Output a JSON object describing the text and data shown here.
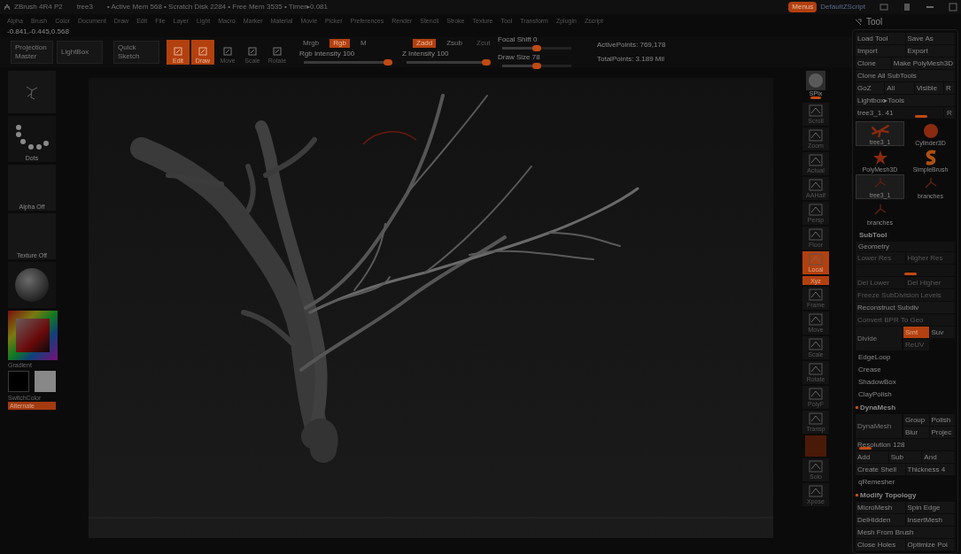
{
  "title_bar": {
    "app": "ZBrush 4R4 P2",
    "document": "tree3",
    "status": "• Active Mem 568 • Scratch Disk 2284 • Free Mem 3535 • Timer▸0.081",
    "menus_button": {
      "label": "Menus",
      "selected": true
    },
    "script": "DefaultZScript"
  },
  "menu_bar": [
    "Alpha",
    "Brush",
    "Color",
    "Document",
    "Draw",
    "Edit",
    "File",
    "Layer",
    "Light",
    "Macro",
    "Marker",
    "Material",
    "Movie",
    "Picker",
    "Preferences",
    "Render",
    "Stencil",
    "Stroke",
    "Texture",
    "Tool",
    "Transform",
    "Zplugin",
    "Zscript"
  ],
  "coordinates": "-0.841,-0.445,0.568",
  "toolbar": {
    "big_buttons": [
      "Projection Master",
      "LightBox",
      "Quick Sketch"
    ],
    "modes": [
      {
        "label": "Edit",
        "selected": true
      },
      {
        "label": "Draw",
        "selected": true
      },
      {
        "label": "Move",
        "selected": false
      },
      {
        "label": "Scale",
        "selected": false
      },
      {
        "label": "Rotate",
        "selected": false
      }
    ],
    "color_modes": [
      {
        "label": "Mrgb",
        "selected": false,
        "disabled": false
      },
      {
        "label": "Rgb",
        "selected": true,
        "disabled": false
      },
      {
        "label": "M",
        "selected": false,
        "disabled": false
      }
    ],
    "z_modes": [
      {
        "label": "Zadd",
        "selected": true,
        "disabled": false
      },
      {
        "label": "Zsub",
        "selected": false,
        "disabled": false
      },
      {
        "label": "Zcut",
        "selected": false,
        "disabled": true
      }
    ],
    "sliders": [
      {
        "label": "Rgb Intensity 100",
        "level": 1
      },
      {
        "label": "Z Intensity 100",
        "level": 1
      },
      {
        "label": "Focal Shift 0",
        "level": 0.5
      },
      {
        "label": "Draw Size 78",
        "level": 0.5
      }
    ],
    "stats": [
      "ActivePoints: 769,178",
      "TotalPoints: 3.189 Mil"
    ]
  },
  "left_shelf": [
    {
      "kind": "brush"
    },
    {
      "kind": "stroke",
      "label": "Dots"
    },
    {
      "kind": "empty",
      "label": "Alpha Off"
    },
    {
      "kind": "empty",
      "label": "Texture Off"
    },
    {
      "kind": "material"
    },
    {
      "kind": "color",
      "label": "Gradient"
    },
    {
      "kind": "swatches",
      "label": "SwitchColor"
    },
    {
      "kind": "button",
      "label": "Alternate"
    }
  ],
  "right_shelf": [
    {
      "kind": "sphere",
      "label": "SPix",
      "selected": false
    },
    {
      "kind": "icon",
      "label": "Scroll",
      "selected": false
    },
    {
      "kind": "icon",
      "label": "Zoom",
      "selected": false
    },
    {
      "kind": "icon",
      "label": "Actual",
      "selected": false
    },
    {
      "kind": "icon",
      "label": "AAHalf",
      "selected": false
    },
    {
      "kind": "icon",
      "label": "Persp",
      "selected": false
    },
    {
      "kind": "icon",
      "label": "Floor",
      "selected": false
    },
    {
      "kind": "icon",
      "label": "Local",
      "selected": true
    },
    {
      "kind": "small",
      "label": "Xyz",
      "selected": true
    },
    {
      "kind": "icon",
      "label": "Frame",
      "selected": false
    },
    {
      "kind": "icon",
      "label": "Move",
      "selected": false
    },
    {
      "kind": "icon",
      "label": "Scale",
      "selected": false
    },
    {
      "kind": "icon",
      "label": "Rotate",
      "selected": false
    },
    {
      "kind": "icon",
      "label": "PolyF",
      "selected": false
    },
    {
      "kind": "icon",
      "label": "Transp",
      "selected": false
    },
    {
      "kind": "blank",
      "selected": true
    },
    {
      "kind": "icon",
      "label": "Solo",
      "selected": false
    },
    {
      "kind": "icon",
      "label": "Xpose",
      "selected": false
    }
  ],
  "tool_palette": {
    "title": "Tool",
    "rows": [
      {
        "kind": "buttons",
        "items": [
          {
            "label": "Load Tool",
            "selected": false,
            "disabled": false
          },
          {
            "label": "Save As",
            "selected": false,
            "disabled": false
          }
        ]
      },
      {
        "kind": "buttons",
        "items": [
          {
            "label": "Import",
            "selected": false,
            "disabled": false
          },
          {
            "label": "Export",
            "selected": false,
            "disabled": false
          }
        ]
      },
      {
        "kind": "buttons",
        "items": [
          {
            "label": "Clone",
            "selected": false,
            "disabled": false
          },
          {
            "label": "Make PolyMesh3D",
            "selected": false,
            "disabled": false
          }
        ]
      },
      {
        "kind": "buttons",
        "items": [
          {
            "label": "Clone All SubTools",
            "selected": false,
            "disabled": false
          }
        ]
      },
      {
        "kind": "buttons",
        "items": [
          {
            "label": "GoZ",
            "selected": false,
            "disabled": false
          },
          {
            "label": "All",
            "selected": false,
            "disabled": false
          },
          {
            "label": "Visible",
            "selected": false,
            "disabled": false
          },
          {
            "label": "R",
            "selected": false,
            "disabled": false
          }
        ]
      },
      {
        "kind": "buttons",
        "items": [
          {
            "label": "Lightbox▸Tools",
            "selected": false,
            "disabled": false
          }
        ]
      },
      {
        "kind": "slider",
        "label": "tree3_1. 41",
        "level": 0.75,
        "button": "R"
      },
      {
        "kind": "thumbs",
        "items": [
          {
            "kind": "tree",
            "label": "tree3_1",
            "selected": true
          },
          {
            "kind": "cylinder",
            "label": "Cylinder3D",
            "selected": false
          },
          {
            "kind": "star",
            "label": "PolyMesh3D",
            "selected": false
          },
          {
            "kind": "s",
            "label": "SimpleBrush",
            "selected": false
          },
          {
            "kind": "branch",
            "label": "tree3_1",
            "selected": true
          },
          {
            "kind": "branch",
            "label": "branches",
            "selected": false
          },
          {
            "kind": "branch",
            "label": "branches",
            "selected": false
          }
        ]
      },
      {
        "kind": "section",
        "label": "SubTool",
        "bullet": false
      },
      {
        "kind": "subsection",
        "label": "Geometry"
      },
      {
        "kind": "buttons",
        "items": [
          {
            "label": "Lower Res",
            "selected": false,
            "disabled": true
          },
          {
            "label": "Higher Res",
            "selected": false,
            "disabled": true
          }
        ]
      },
      {
        "kind": "slider",
        "level": 0.55
      },
      {
        "kind": "buttons",
        "items": [
          {
            "label": "Del Lower",
            "selected": false,
            "disabled": true
          },
          {
            "label": "Del Higher",
            "selected": false,
            "disabled": true
          }
        ]
      },
      {
        "kind": "buttons",
        "items": [
          {
            "label": "Freeze SubDivision Levels",
            "selected": false,
            "disabled": true
          }
        ]
      },
      {
        "kind": "buttons",
        "items": [
          {
            "label": "Reconstruct Subdiv",
            "selected": false,
            "disabled": false
          }
        ]
      },
      {
        "kind": "buttons",
        "items": [
          {
            "label": "Convert BPR To Geo",
            "selected": false,
            "disabled": true
          }
        ]
      },
      {
        "kind": "split",
        "label": "Divide",
        "items": [
          {
            "label": "Smt",
            "selected": true,
            "disabled": false
          },
          {
            "label": "Suv",
            "selected": false,
            "disabled": false
          },
          {
            "label": "ReUV",
            "selected": false,
            "disabled": true
          }
        ]
      },
      {
        "kind": "label",
        "label": "EdgeLoop"
      },
      {
        "kind": "label",
        "label": "Crease"
      },
      {
        "kind": "label",
        "label": "ShadowBox"
      },
      {
        "kind": "label",
        "label": "ClayPolish"
      },
      {
        "kind": "section",
        "label": "DynaMesh",
        "bullet": true
      },
      {
        "kind": "split",
        "label": "DynaMesh",
        "items": [
          {
            "label": "Group",
            "selected": false,
            "disabled": false
          },
          {
            "label": "Polish",
            "selected": false,
            "disabled": false
          },
          {
            "label": "Blur",
            "selected": false,
            "disabled": false
          },
          {
            "label": "Projec",
            "selected": false,
            "disabled": false
          }
        ]
      },
      {
        "kind": "slider",
        "label": "Resolution 128",
        "level": 0.1
      },
      {
        "kind": "buttons",
        "items": [
          {
            "label": "Add",
            "selected": false,
            "disabled": false
          },
          {
            "label": "Sub",
            "selected": false,
            "disabled": false
          },
          {
            "label": "And",
            "selected": false,
            "disabled": false
          }
        ]
      },
      {
        "kind": "buttons",
        "items": [
          {
            "label": "Create Shell",
            "selected": false,
            "disabled": false
          },
          {
            "label": "Thickness 4",
            "selected": false,
            "disabled": false
          }
        ]
      },
      {
        "kind": "label",
        "label": "qRemesher"
      },
      {
        "kind": "section",
        "label": "Modify Topology",
        "bullet": true
      },
      {
        "kind": "buttons",
        "items": [
          {
            "label": "MicroMesh",
            "selected": false,
            "disabled": false
          },
          {
            "label": "Spin Edge",
            "selected": false,
            "disabled": false
          }
        ]
      },
      {
        "kind": "buttons",
        "items": [
          {
            "label": "DelHidden",
            "selected": false,
            "disabled": false
          },
          {
            "label": "InsertMesh",
            "selected": false,
            "disabled": false
          }
        ]
      },
      {
        "kind": "buttons",
        "items": [
          {
            "label": "Mesh From Brush",
            "selected": false,
            "disabled": false
          }
        ]
      },
      {
        "kind": "buttons",
        "items": [
          {
            "label": "Close Holes",
            "selected": false,
            "disabled": false
          },
          {
            "label": "Optimize Poi",
            "selected": false,
            "disabled": false
          }
        ]
      }
    ]
  }
}
